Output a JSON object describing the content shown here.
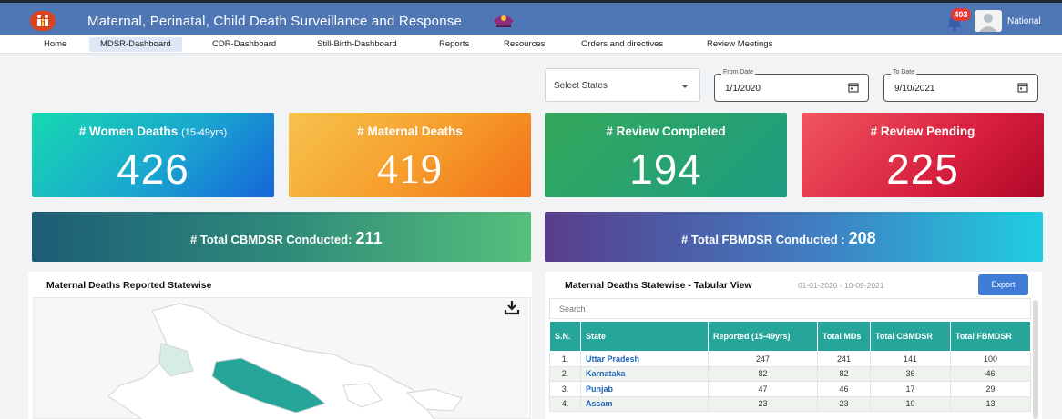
{
  "header": {
    "title": "Maternal, Perinatal, Child Death Surveillance and Response",
    "notification_count": "403",
    "user_label": "National"
  },
  "nav": {
    "items": [
      "Home",
      "MDSR-Dashboard",
      "CDR-Dashboard",
      "Still-Birth-Dashboard",
      "Reports",
      "Resources",
      "Orders and directives",
      "Review Meetings"
    ],
    "active": "MDSR-Dashboard"
  },
  "filters": {
    "state_select": "Select States",
    "from_label": "From Date",
    "from_value": "1/1/2020",
    "to_label": "To Date",
    "to_value": "9/10/2021"
  },
  "cards": {
    "women": {
      "label": "# Women Deaths",
      "sub": "(15-49yrs)",
      "value": "426"
    },
    "maternal": {
      "label": "# Maternal Deaths",
      "value": "419"
    },
    "completed": {
      "label": "# Review Completed",
      "value": "194"
    },
    "pending": {
      "label": "# Review Pending",
      "value": "225"
    }
  },
  "totals": {
    "cbmdsr_label": "# Total CBMDSR Conducted:",
    "cbmdsr_value": "211",
    "fbmdsr_label": "# Total FBMDSR Conducted :",
    "fbmdsr_value": "208"
  },
  "map_panel": {
    "title": "Maternal Deaths Reported Statewise"
  },
  "table_panel": {
    "title": "Maternal Deaths Statewise - Tabular View",
    "daterange": "01-01-2020 - 10-09-2021",
    "export_label": "Export",
    "search_placeholder": "Search",
    "columns": [
      "S.N.",
      "State",
      "Reported (15-49yrs)",
      "Total MDs",
      "Total CBMDSR",
      "Total FBMDSR"
    ],
    "rows": [
      [
        "1.",
        "Uttar Pradesh",
        "247",
        "241",
        "141",
        "100"
      ],
      [
        "2.",
        "Karnataka",
        "82",
        "82",
        "36",
        "46"
      ],
      [
        "3.",
        "Punjab",
        "47",
        "46",
        "17",
        "29"
      ],
      [
        "4.",
        "Assam",
        "23",
        "23",
        "10",
        "13"
      ]
    ]
  },
  "colors": {
    "header_bg": "#4f77b5",
    "accent_teal": "#26a69a",
    "link_blue": "#1e63b8",
    "export_blue": "#3f7cd6"
  }
}
